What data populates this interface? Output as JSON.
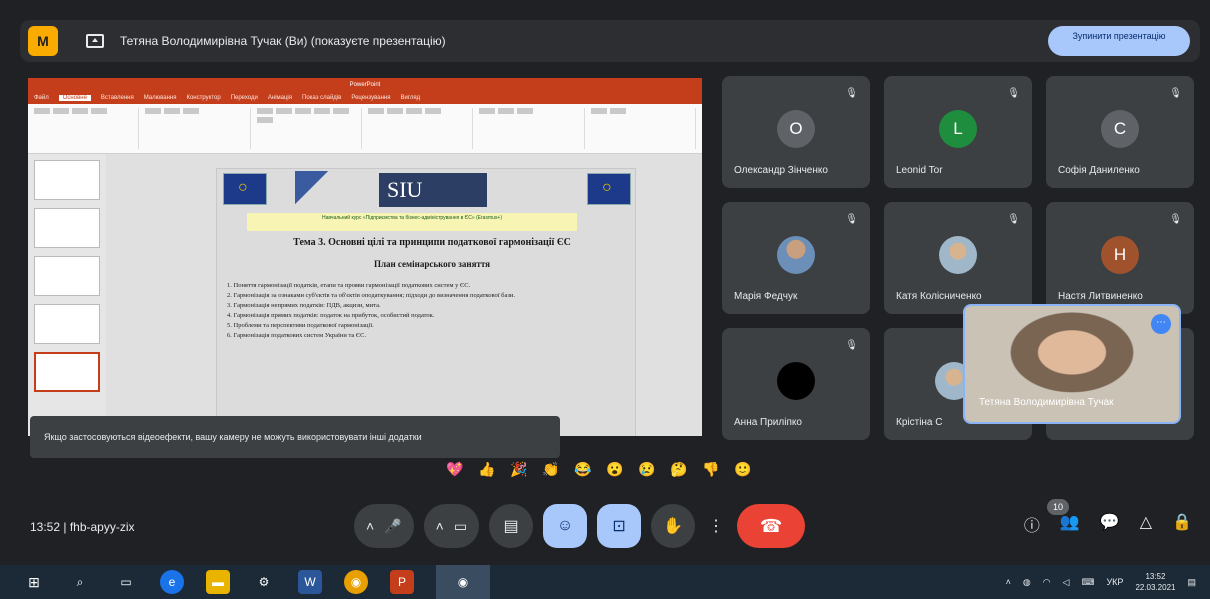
{
  "top_bar": {
    "logo_letter": "M",
    "presenter_text": "Тетяна Володимирівна Тучак (Ви) (показуєте презентацію)",
    "stop_button": "Зупинити презентацію"
  },
  "shared_screen": {
    "app_title": "PowerPoint",
    "tabs": [
      "Файл",
      "Основне",
      "Вставлення",
      "Малювання",
      "Конструктор",
      "Переходи",
      "Анімація",
      "Показ слайдів",
      "Рецензування",
      "Вигляд"
    ],
    "slide": {
      "logo_text": "SIU",
      "banner": "Навчальний курс «Підприємства та бізнес-адміністрування в ЄС» (Erasmus+)",
      "heading": "Тема 3. Основні цілі та принципи податкової гармонізації ЄС",
      "subheading": "План семінарського заняття",
      "points": [
        "1. Поняття гармонізації податків, етапи та прояви гармонізації податкових систем у ЄС.",
        "2. Гармонізація за ознаками суб'єктів та об'єктів оподаткування; підходи до визначення податкової бази.",
        "3. Гармонізація непрямих податків: ПДВ, акцизи, мита.",
        "4. Гармонізація прямих податків: податок на прибуток, особистий податок.",
        "5. Проблеми та перспективи податкової гармонізації.",
        "6. Гармонізація податкових систем України та ЄС."
      ]
    }
  },
  "toast": "Якщо застосовуються відеоефекти, вашу камеру не можуть використовувати інші додатки",
  "participants": [
    {
      "name": "Олександр Зінченко",
      "initial": "О",
      "color": "#5f6368"
    },
    {
      "name": "Leonid Tor",
      "initial": "L",
      "color": "#1e8e3e"
    },
    {
      "name": "Софія Даниленко",
      "initial": "С",
      "color": "#5f6368"
    },
    {
      "name": "Марія Федчук",
      "initial": "",
      "color": ""
    },
    {
      "name": "Катя Колісниченко",
      "initial": "",
      "color": ""
    },
    {
      "name": "Настя Литвиненко",
      "initial": "Н",
      "color": "#a0522d"
    },
    {
      "name": "Анна Приліпко",
      "initial": "",
      "color": "#000000"
    },
    {
      "name": "Крістіна С",
      "initial": "",
      "color": ""
    }
  ],
  "self_view": {
    "name": "Тетяна Володимирівна Тучак"
  },
  "reactions": [
    "💖",
    "👍",
    "🎉",
    "👏",
    "😂",
    "😮",
    "😢",
    "🤔",
    "👎",
    "🙂"
  ],
  "meeting_info": {
    "time": "13:52",
    "code": "fhb-apyy-zix"
  },
  "participants_badge": "10",
  "taskbar": {
    "tray_lang": "УКР",
    "clock_time": "13:52",
    "clock_date": "22.03.2021"
  }
}
